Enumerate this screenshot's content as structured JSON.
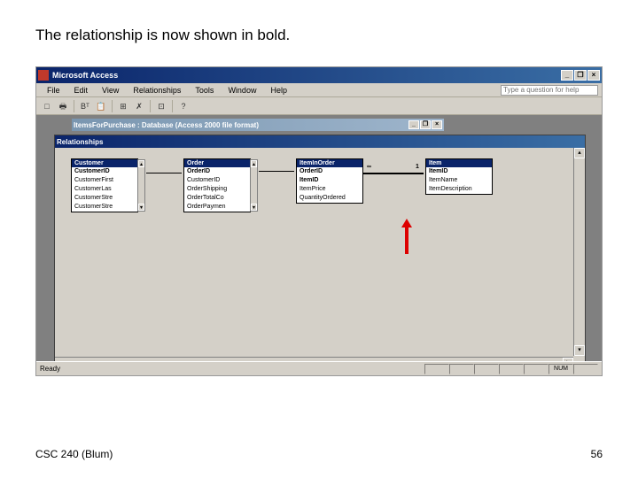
{
  "slide": {
    "title": "The relationship is now shown in bold.",
    "footer_left": "CSC 240 (Blum)",
    "footer_right": "56"
  },
  "app": {
    "title": "Microsoft Access",
    "min": "_",
    "restore": "❐",
    "close": "×"
  },
  "menu": {
    "items": [
      "File",
      "Edit",
      "View",
      "Relationships",
      "Tools",
      "Window",
      "Help"
    ],
    "help_placeholder": "Type a question for help"
  },
  "toolbar": {
    "icons": [
      "□",
      "🖶",
      "",
      "Bᵀ",
      "📋",
      "",
      "⊞",
      "✗",
      "",
      "⊡",
      "",
      "?"
    ]
  },
  "db_window": {
    "title": "ItemsForPurchase : Database (Access 2000 file format)"
  },
  "rel_window": {
    "title": "Relationships"
  },
  "tables": {
    "customer": {
      "name": "Customer",
      "fields": [
        "CustomerID",
        "CustomerFirst",
        "CustomerLas",
        "CustomerStre",
        "CustomerStre"
      ]
    },
    "order": {
      "name": "Order",
      "fields": [
        "OrderID",
        "CustomerID",
        "OrderShipping",
        "OrderTotalCo",
        "OrderPaymen"
      ]
    },
    "iteminorder": {
      "name": "ItemInOrder",
      "fields": [
        "OrderID",
        "ItemID",
        "ItemPrice",
        "QuantityOrdered"
      ]
    },
    "item": {
      "name": "Item",
      "fields": [
        "ItemID",
        "ItemName",
        "ItemDescription"
      ]
    }
  },
  "relation": {
    "one": "1",
    "many": "∞"
  },
  "status": {
    "ready": "Ready",
    "num": "NUM"
  }
}
